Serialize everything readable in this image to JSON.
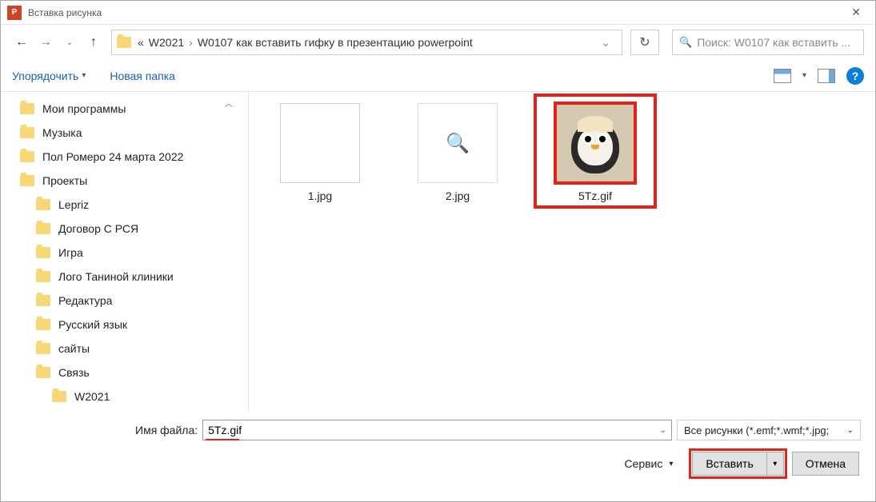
{
  "title": "Вставка рисунка",
  "app_icon_text": "P",
  "breadcrumb": {
    "prefix": "«",
    "part1": "W2021",
    "part2": "W0107 как вставить гифку в презентацию powerpoint"
  },
  "search_placeholder": "Поиск: W0107 как вставить ...",
  "toolbar": {
    "organize": "Упорядочить",
    "new_folder": "Новая папка"
  },
  "tree": [
    {
      "label": "Мои программы",
      "indent": 0
    },
    {
      "label": "Музыка",
      "indent": 0
    },
    {
      "label": "Пол Ромеро 24 марта 2022",
      "indent": 0
    },
    {
      "label": "Проекты",
      "indent": 0
    },
    {
      "label": "Lepriz",
      "indent": 1
    },
    {
      "label": "Договор С РСЯ",
      "indent": 1
    },
    {
      "label": "Игра",
      "indent": 1
    },
    {
      "label": "Лого Таниной клиники",
      "indent": 1
    },
    {
      "label": "Редактура",
      "indent": 1
    },
    {
      "label": "Русский язык",
      "indent": 1
    },
    {
      "label": "сайты",
      "indent": 1
    },
    {
      "label": "Связь",
      "indent": 1
    },
    {
      "label": "W2021",
      "indent": 2
    }
  ],
  "files": [
    {
      "name": "1.jpg",
      "selected": false,
      "type": "doc"
    },
    {
      "name": "2.jpg",
      "selected": false,
      "type": "search"
    },
    {
      "name": "5Tz.gif",
      "selected": true,
      "type": "penguin"
    }
  ],
  "file_label": "Имя файла:",
  "file_value": "5Tz.gif",
  "filter": "Все рисунки (*.emf;*.wmf;*.jpg; ",
  "service": "Сервис",
  "insert": "Вставить",
  "cancel": "Отмена",
  "help": "?"
}
